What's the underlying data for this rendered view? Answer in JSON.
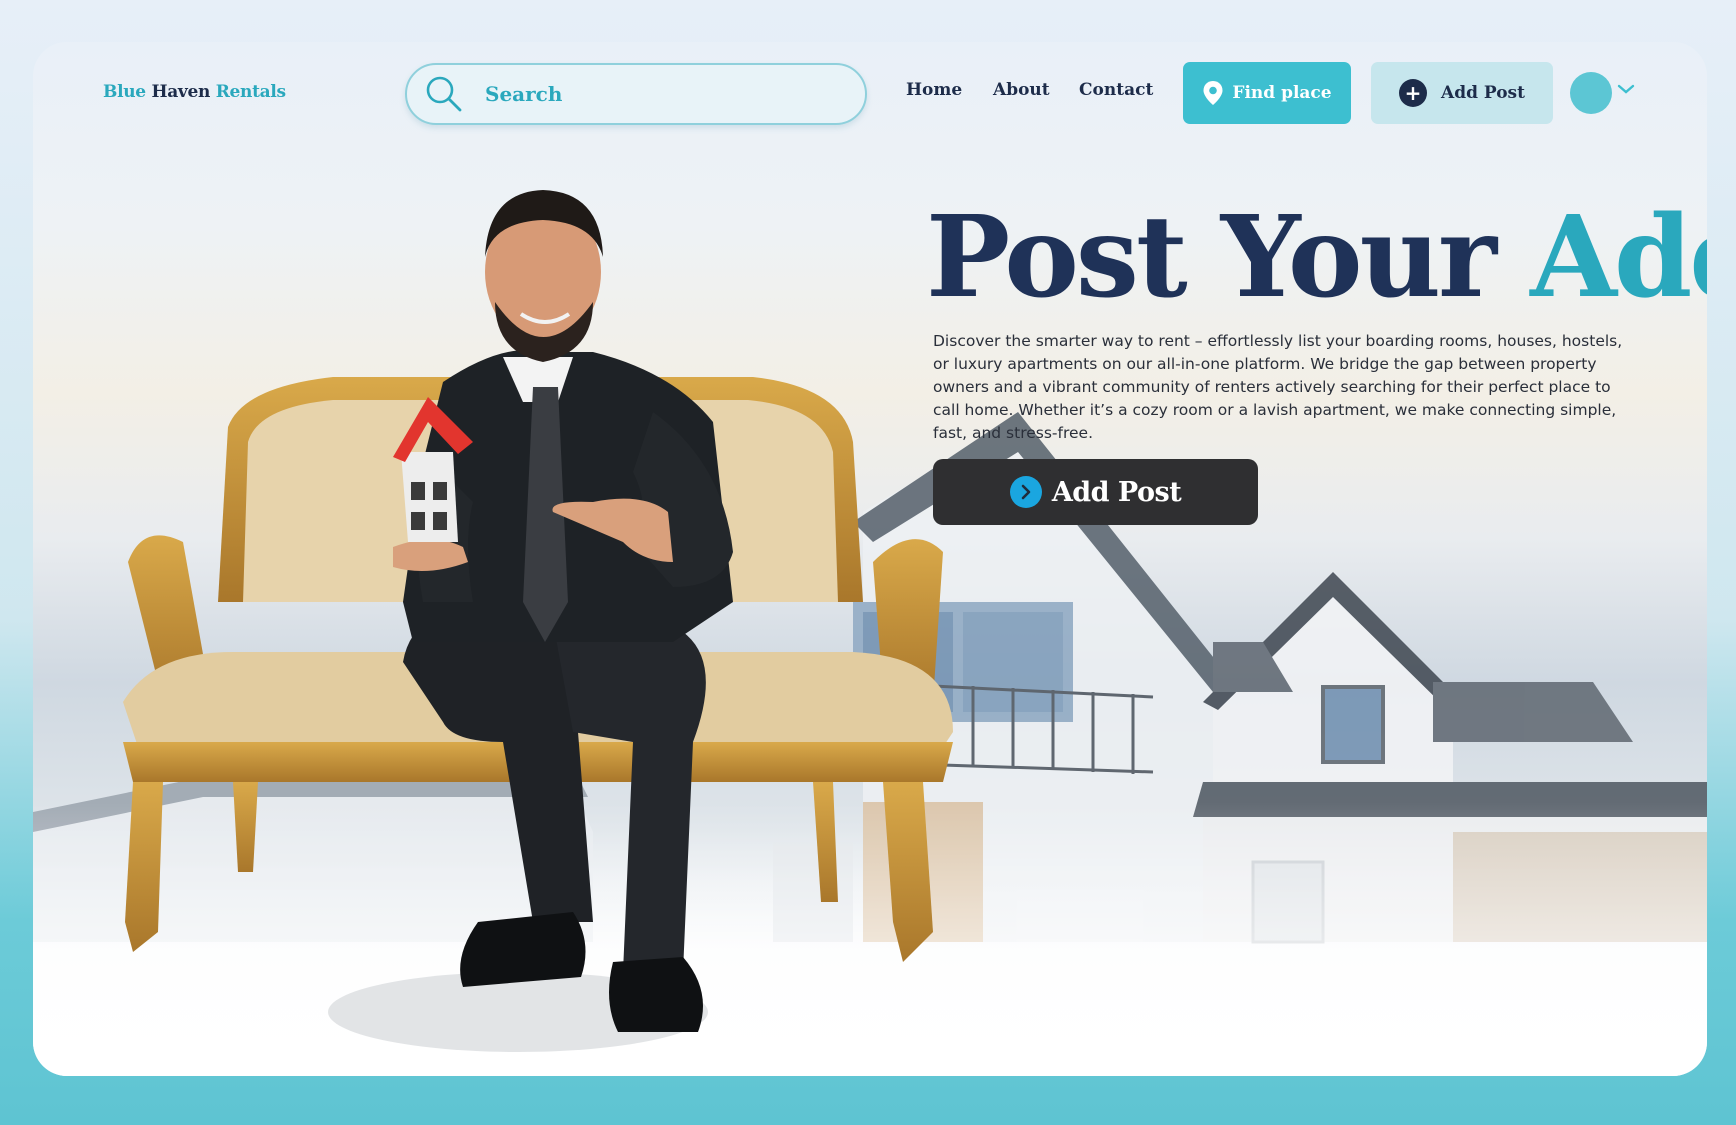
{
  "header": {
    "logo": {
      "part1": "Blue",
      "part2": "Haven",
      "part3": "Rentals"
    },
    "search": {
      "placeholder": "Search",
      "icon": "search-icon"
    },
    "nav": {
      "home": "Home",
      "about": "About",
      "contact": "Contact"
    },
    "find_place_label": "Find place",
    "add_post_label": "Add Post"
  },
  "hero": {
    "headline_part1": "Post Your",
    "headline_part2": "Add",
    "description": "Discover the smarter way to rent – effortlessly list your boarding rooms, houses, hostels, or luxury apartments on our all-in-one platform. We bridge the gap between property owners and a vibrant community of renters actively searching for their perfect place to call home. Whether it’s a cozy room or a lavish apartment, we make connecting simple, fast, and stress-free.",
    "cta_label": "Add Post"
  },
  "colors": {
    "accent": "#2aa8bd",
    "navy": "#1f3258",
    "teal_bg": "#5ec4d2",
    "cta_dark": "#2f2f31"
  }
}
